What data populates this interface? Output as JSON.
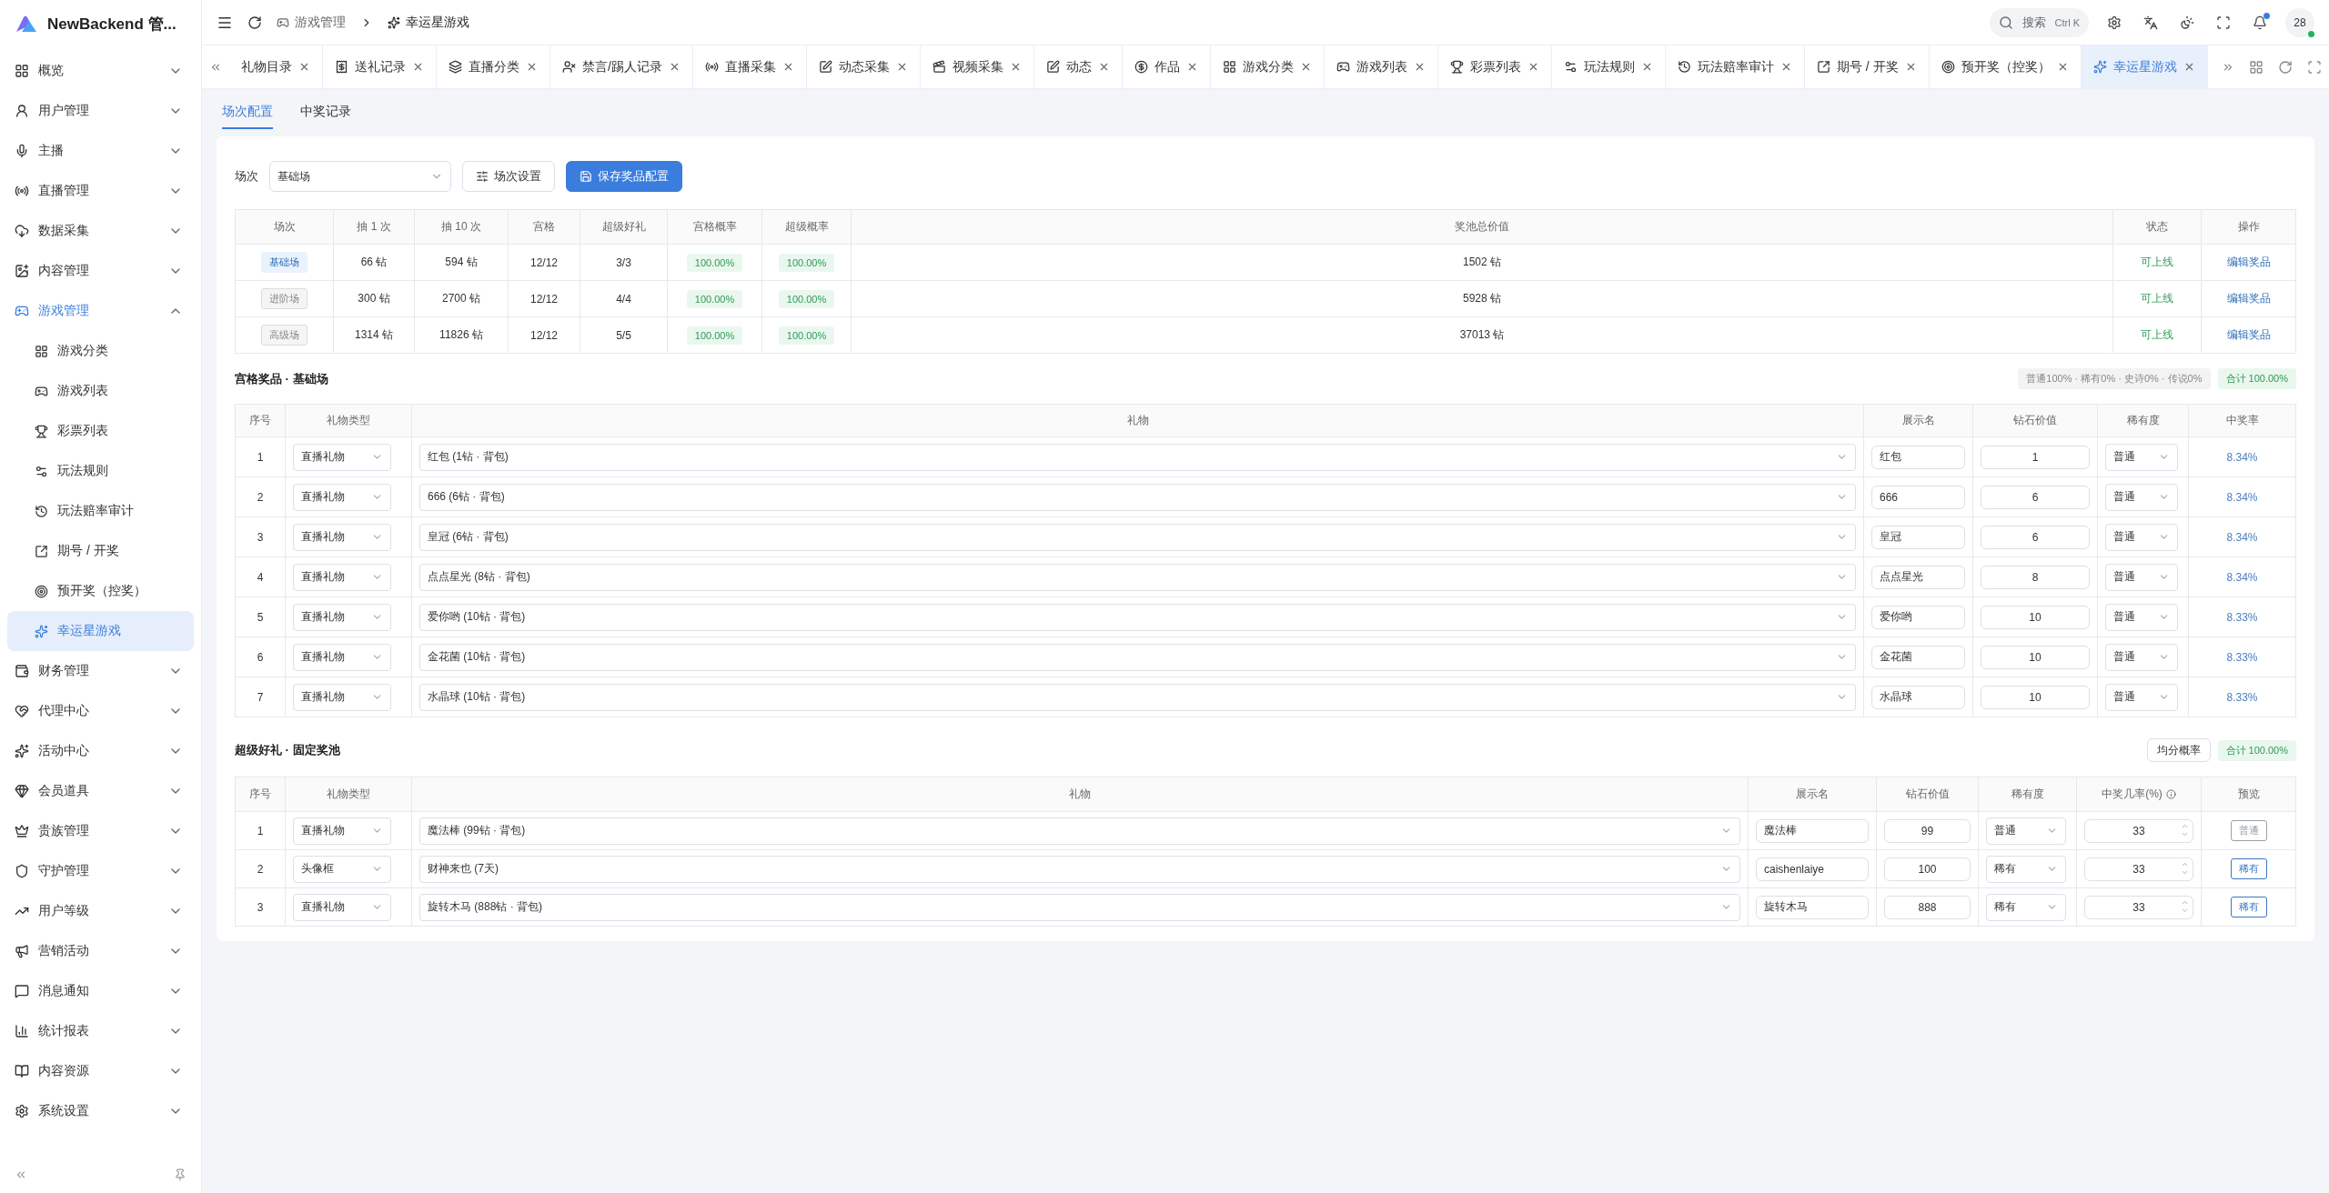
{
  "brand": {
    "name": "NewBackend 管..."
  },
  "sidebar": {
    "items": [
      {
        "label": "概览",
        "expanded": false,
        "selected": false
      },
      {
        "label": "用户管理",
        "expanded": false,
        "selected": false
      },
      {
        "label": "主播",
        "expanded": false,
        "selected": false
      },
      {
        "label": "直播管理",
        "expanded": false,
        "selected": false
      },
      {
        "label": "数据采集",
        "expanded": false,
        "selected": false
      },
      {
        "label": "内容管理",
        "expanded": false,
        "selected": false
      },
      {
        "label": "游戏管理",
        "expanded": true,
        "selected": false,
        "children": [
          {
            "label": "游戏分类",
            "selected": false
          },
          {
            "label": "游戏列表",
            "selected": false
          },
          {
            "label": "彩票列表",
            "selected": false
          },
          {
            "label": "玩法规则",
            "selected": false
          },
          {
            "label": "玩法赔率审计",
            "selected": false
          },
          {
            "label": "期号 / 开奖",
            "selected": false
          },
          {
            "label": "预开奖（控奖）",
            "selected": false
          },
          {
            "label": "幸运星游戏",
            "selected": true
          }
        ]
      },
      {
        "label": "财务管理",
        "expanded": false,
        "selected": false
      },
      {
        "label": "代理中心",
        "expanded": false,
        "selected": false
      },
      {
        "label": "活动中心",
        "expanded": false,
        "selected": false
      },
      {
        "label": "会员道具",
        "expanded": false,
        "selected": false
      },
      {
        "label": "贵族管理",
        "expanded": false,
        "selected": false
      },
      {
        "label": "守护管理",
        "expanded": false,
        "selected": false
      },
      {
        "label": "用户等级",
        "expanded": false,
        "selected": false
      },
      {
        "label": "营销活动",
        "expanded": false,
        "selected": false
      },
      {
        "label": "消息通知",
        "expanded": false,
        "selected": false
      },
      {
        "label": "统计报表",
        "expanded": false,
        "selected": false
      },
      {
        "label": "内容资源",
        "expanded": false,
        "selected": false
      },
      {
        "label": "系统设置",
        "expanded": false,
        "selected": false
      }
    ]
  },
  "header": {
    "breadcrumb": [
      "游戏管理",
      "幸运星游戏"
    ],
    "search": {
      "placeholder": "搜索",
      "shortcut": "Ctrl K"
    },
    "notification_dot": true,
    "avatar": {
      "label": "28",
      "online": true
    }
  },
  "tabs": [
    {
      "label": "礼物目录",
      "selected": false
    },
    {
      "label": "送礼记录",
      "selected": false
    },
    {
      "label": "直播分类",
      "selected": false
    },
    {
      "label": "禁言/踢人记录",
      "selected": false
    },
    {
      "label": "直播采集",
      "selected": false
    },
    {
      "label": "动态采集",
      "selected": false
    },
    {
      "label": "视频采集",
      "selected": false
    },
    {
      "label": "动态",
      "selected": false
    },
    {
      "label": "作品",
      "selected": false
    },
    {
      "label": "游戏分类",
      "selected": false
    },
    {
      "label": "游戏列表",
      "selected": false
    },
    {
      "label": "彩票列表",
      "selected": false
    },
    {
      "label": "玩法规则",
      "selected": false
    },
    {
      "label": "玩法赔率审计",
      "selected": false
    },
    {
      "label": "期号 / 开奖",
      "selected": false
    },
    {
      "label": "预开奖（控奖）",
      "selected": false
    },
    {
      "label": "幸运星游戏",
      "selected": true
    }
  ],
  "subtabs": [
    {
      "label": "场次配置",
      "selected": true
    },
    {
      "label": "中奖记录",
      "selected": false
    }
  ],
  "toolbar": {
    "label": "场次",
    "select": "基础场",
    "settings_button": "场次设置",
    "save_button": "保存奖品配置"
  },
  "sessions": {
    "columns": [
      "场次",
      "抽 1 次",
      "抽 10 次",
      "宫格",
      "超级好礼",
      "宫格概率",
      "超级概率",
      "奖池总价值",
      "状态",
      "操作"
    ],
    "rows": [
      {
        "name": "基础场",
        "selected": true,
        "draw_1": "66 钻",
        "draw_10": "594 钻",
        "grid": "12/12",
        "super": "3/3",
        "grid_rate": "100.00%",
        "super_rate": "100.00%",
        "total": "1502 钻",
        "status": "可上线",
        "action": "编辑奖品"
      },
      {
        "name": "进阶场",
        "selected": false,
        "draw_1": "300 钻",
        "draw_10": "2700 钻",
        "grid": "12/12",
        "super": "4/4",
        "grid_rate": "100.00%",
        "super_rate": "100.00%",
        "total": "5928 钻",
        "status": "可上线",
        "action": "编辑奖品"
      },
      {
        "name": "高级场",
        "selected": false,
        "draw_1": "1314 钻",
        "draw_10": "11826 钻",
        "grid": "12/12",
        "super": "5/5",
        "grid_rate": "100.00%",
        "super_rate": "100.00%",
        "total": "37013 钻",
        "status": "可上线",
        "action": "编辑奖品"
      }
    ]
  },
  "grid_prizes": {
    "title": "宫格奖品 · 基础场",
    "summary": "普通100% · 稀有0% · 史诗0% · 传说0%",
    "total": "合计 100.00%",
    "columns": [
      "序号",
      "礼物类型",
      "礼物",
      "展示名",
      "钻石价值",
      "稀有度",
      "中奖率"
    ],
    "rows": [
      {
        "index": "1",
        "type": "直播礼物",
        "gift": "红包 (1钻 · 背包)",
        "display": "红包",
        "value": "1",
        "rarity": "普通",
        "rate": "8.34%"
      },
      {
        "index": "2",
        "type": "直播礼物",
        "gift": "666 (6钻 · 背包)",
        "display": "666",
        "value": "6",
        "rarity": "普通",
        "rate": "8.34%"
      },
      {
        "index": "3",
        "type": "直播礼物",
        "gift": "皇冠 (6钻 · 背包)",
        "display": "皇冠",
        "value": "6",
        "rarity": "普通",
        "rate": "8.34%"
      },
      {
        "index": "4",
        "type": "直播礼物",
        "gift": "点点星光 (8钻 · 背包)",
        "display": "点点星光",
        "value": "8",
        "rarity": "普通",
        "rate": "8.34%"
      },
      {
        "index": "5",
        "type": "直播礼物",
        "gift": "爱你哟 (10钻 · 背包)",
        "display": "爱你哟",
        "value": "10",
        "rarity": "普通",
        "rate": "8.33%"
      },
      {
        "index": "6",
        "type": "直播礼物",
        "gift": "金花菌 (10钻 · 背包)",
        "display": "金花菌",
        "value": "10",
        "rarity": "普通",
        "rate": "8.33%"
      },
      {
        "index": "7",
        "type": "直播礼物",
        "gift": "水晶球 (10钻 · 背包)",
        "display": "水晶球",
        "value": "10",
        "rarity": "普通",
        "rate": "8.33%"
      }
    ]
  },
  "super_prizes": {
    "title": "超级好礼 · 固定奖池",
    "button": "均分概率",
    "total": "合计 100.00%",
    "columns": [
      "序号",
      "礼物类型",
      "礼物",
      "展示名",
      "钻石价值",
      "稀有度",
      "中奖几率(%)",
      "预览"
    ],
    "rows": [
      {
        "index": "1",
        "type": "直播礼物",
        "gift": "魔法棒 (99钻 · 背包)",
        "display": "魔法棒",
        "value": "99",
        "rarity": "普通",
        "rate": "33",
        "preview": {
          "label": "普通",
          "color": "#9aa0a6"
        }
      },
      {
        "index": "2",
        "type": "头像框",
        "gift": "财神来也 (7天)",
        "display": "caishenlaiye",
        "value": "100",
        "rarity": "稀有",
        "rate": "33",
        "preview": {
          "label": "稀有",
          "color": "#3a78c4"
        }
      },
      {
        "index": "3",
        "type": "直播礼物",
        "gift": "旋转木马 (888钻 · 背包)",
        "display": "旋转木马",
        "value": "888",
        "rarity": "稀有",
        "rate": "33",
        "preview": {
          "label": "稀有",
          "color": "#3a78c4"
        }
      }
    ]
  }
}
